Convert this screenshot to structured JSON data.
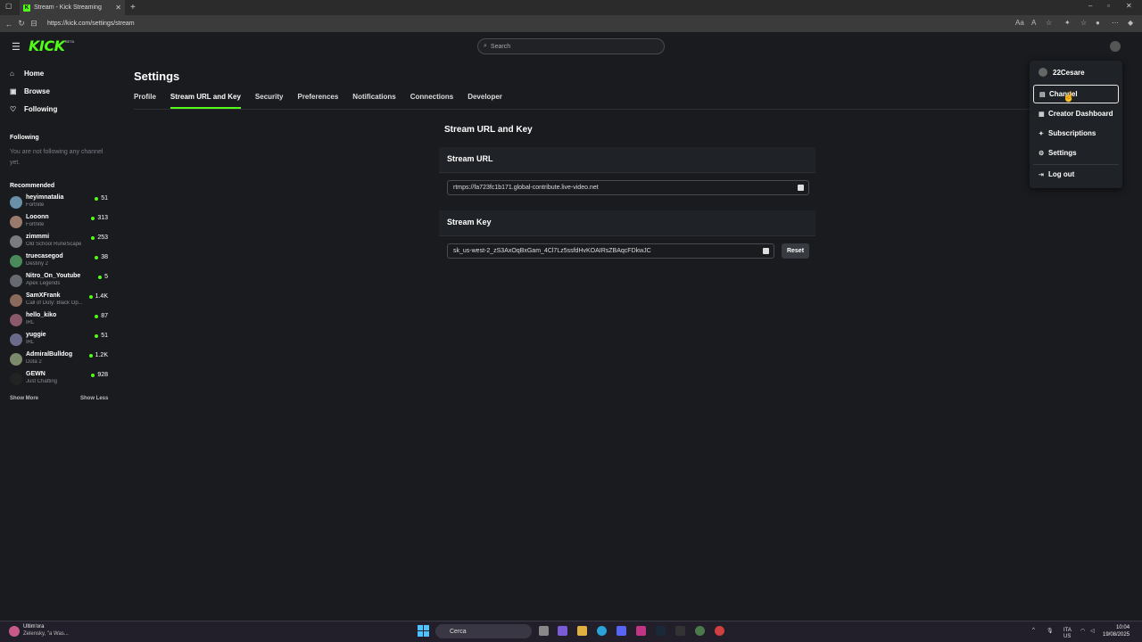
{
  "browser": {
    "tab_title": "Stream - Kick Streaming",
    "favicon": "K",
    "url": "https://kick.com/settings/stream"
  },
  "header": {
    "logo": "KICK",
    "logo_badge": "BETA",
    "search_placeholder": "Search"
  },
  "sidebar": {
    "nav": [
      {
        "label": "Home",
        "icon": "home-icon"
      },
      {
        "label": "Browse",
        "icon": "browse-icon"
      },
      {
        "label": "Following",
        "icon": "heart-icon"
      }
    ],
    "following_title": "Following",
    "following_empty": "You are not following any channel yet.",
    "recommended_title": "Recommended",
    "recommended": [
      {
        "name": "heyimnatalia",
        "game": "Fortnite",
        "viewers": "51"
      },
      {
        "name": "Looonn",
        "game": "Fortnite",
        "viewers": "313"
      },
      {
        "name": "zimmmi",
        "game": "Old School RuneScape",
        "viewers": "253"
      },
      {
        "name": "truecasegod",
        "game": "Destiny 2",
        "viewers": "38"
      },
      {
        "name": "Nitro_On_Youtube",
        "game": "Apex Legends",
        "viewers": "5"
      },
      {
        "name": "SamXFrank",
        "game": "Call of Duty: Black Op...",
        "viewers": "1.4K"
      },
      {
        "name": "hello_kiko",
        "game": "IRL",
        "viewers": "87"
      },
      {
        "name": "yuggie",
        "game": "IRL",
        "viewers": "51"
      },
      {
        "name": "AdmiralBulldog",
        "game": "Dota 2",
        "viewers": "1.2K"
      },
      {
        "name": "GEWN",
        "game": "Just Chatting",
        "viewers": "928"
      }
    ],
    "show_more": "Show More",
    "show_less": "Show Less"
  },
  "settings": {
    "title": "Settings",
    "tabs": [
      "Profile",
      "Stream URL and Key",
      "Security",
      "Preferences",
      "Notifications",
      "Connections",
      "Developer"
    ],
    "active_tab": "Stream URL and Key",
    "section_title": "Stream URL and Key",
    "stream_url_label": "Stream URL",
    "stream_url_value": "rtmps://fa723fc1b171.global-contribute.live-video.net",
    "stream_key_label": "Stream Key",
    "stream_key_value": "sk_us-west-2_zS3AxOqBxGam_4Cl7Lz5ssfdHvKOAIRsZBAqcFDkwJC",
    "reset_label": "Reset"
  },
  "user_menu": {
    "username": "22Cesare",
    "items": [
      {
        "label": "Channel",
        "icon": "channel-icon"
      },
      {
        "label": "Creator Dashboard",
        "icon": "dashboard-icon"
      },
      {
        "label": "Subscriptions",
        "icon": "subscriptions-icon"
      },
      {
        "label": "Settings",
        "icon": "gear-icon"
      },
      {
        "label": "Log out",
        "icon": "logout-icon"
      }
    ]
  },
  "taskbar": {
    "news_title": "Ultim'ora",
    "news_text": "Zelensky, \"a Was...",
    "search": "Cerca",
    "lang": "ITA",
    "region": "US",
    "time": "10:04",
    "date": "19/08/2025"
  },
  "colors": {
    "accent": "#53fc18",
    "bg": "#191b1f"
  }
}
